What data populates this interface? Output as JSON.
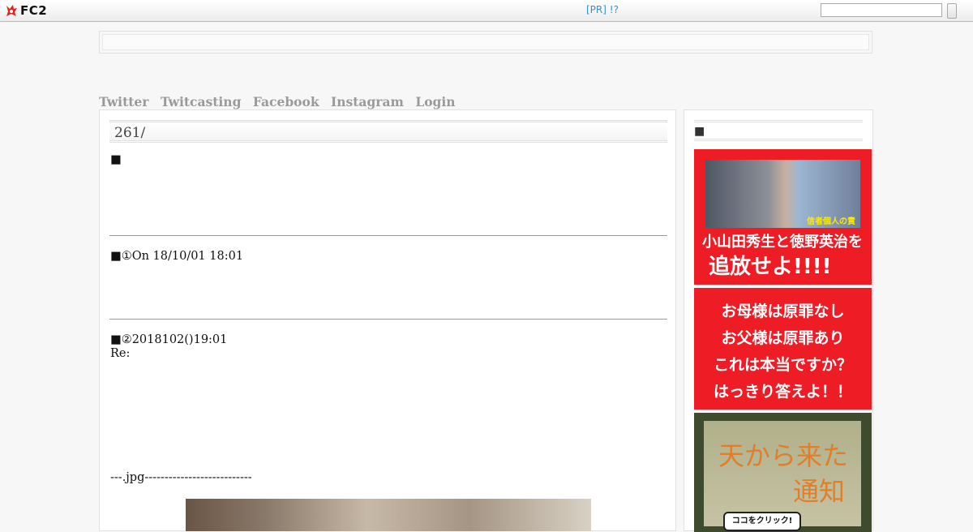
{
  "header": {
    "logo_text": "FC2",
    "pr_link": "[PR] !?",
    "search": {
      "placeholder": "",
      "value": ""
    }
  },
  "nav": {
    "links": [
      "Twitter",
      "Twitcasting",
      "Facebook",
      "Instagram",
      "Login"
    ]
  },
  "entry": {
    "title": "261/",
    "sections": [
      {
        "heading": "■"
      },
      {
        "heading": "■①On 18/10/01 18:01"
      },
      {
        "heading": "■②2018102()19:01",
        "line2": "Re:"
      }
    ],
    "attachment_line": "---.jpg---------------------------"
  },
  "sidebar": {
    "heading": "■",
    "banner1": {
      "line1": "小山田秀生と徳野英治を",
      "line2": "追放せよ!!!!",
      "photo_tag": "信者個人の責"
    },
    "banner2": {
      "lines": [
        "お母様は原罪なし",
        "お父様は原罪あり",
        "これは本当ですか？",
        "はっきり答えよ！！"
      ]
    },
    "banner3": {
      "title1": "天から来た",
      "title2": "通知",
      "button": "ココをクリック!"
    }
  },
  "colors": {
    "banner_red": "#ee1c25",
    "link_blue": "#3a8fd0",
    "nav_gray": "#9a9a9a"
  }
}
